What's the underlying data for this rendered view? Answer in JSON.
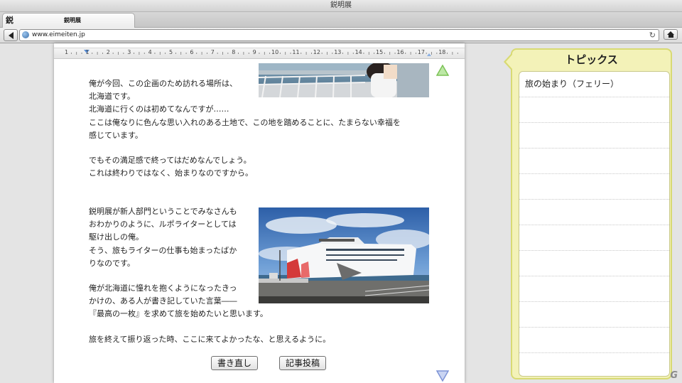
{
  "window": {
    "title": "鋭明展"
  },
  "tab": {
    "icon_glyph": "鋭",
    "label": "鋭明展"
  },
  "address_bar": {
    "url": "www.eimeiten.jp"
  },
  "ruler": {
    "numbers": [
      "1",
      "1",
      "2",
      "3",
      "4",
      "5",
      "6",
      "7",
      "8",
      "9",
      "10",
      "11",
      "12",
      "13",
      "14",
      "15",
      "16",
      "17",
      "18"
    ]
  },
  "article": {
    "para1": [
      "俺が今回、この企画のため訪れる場所は、",
      "北海道です。",
      "北海道に行くのは初めてなんですが……",
      "ここは俺なりに色んな思い入れのある土地で、この地を踏めることに、たまらない幸福を",
      "感じています。"
    ],
    "para2": [
      "でもその満足感で終ってはだめなんでしょう。",
      "これは終わりではなく、始まりなのですから。"
    ],
    "para3": [
      "鋭明展が新人部門ということでみなさんも",
      "おわかりのように、ルポライターとしては",
      "駆け出しの俺。",
      "そう、旅もライターの仕事も始まったばか",
      "りなのです。"
    ],
    "para4": [
      "俺が北海道に憧れを抱くようになったきっ",
      "かけの、ある人が書き記していた言葉――",
      "『最高の一枚』を求めて旅を始めたいと思います。"
    ],
    "para5": [
      "旅を終えて振り返った時、ここに来てよかったな、と思えるように。"
    ]
  },
  "buttons": {
    "rewrite": "書き直し",
    "post": "記事投稿"
  },
  "topics": {
    "header": "トピックス",
    "items": [
      "旅の始まり（フェリー）",
      "",
      "",
      "",
      "",
      "",
      "",
      "",
      "",
      "",
      "",
      ""
    ]
  },
  "watermark": "G",
  "colors": {
    "panel_bg": "#f3f2b8",
    "panel_border": "#d8da73",
    "scroll_arrow": "#8fd06b"
  },
  "icons": [
    "back-arrow-icon",
    "globe-icon",
    "reload-icon",
    "home-icon",
    "scroll-up-icon",
    "scroll-down-icon"
  ]
}
